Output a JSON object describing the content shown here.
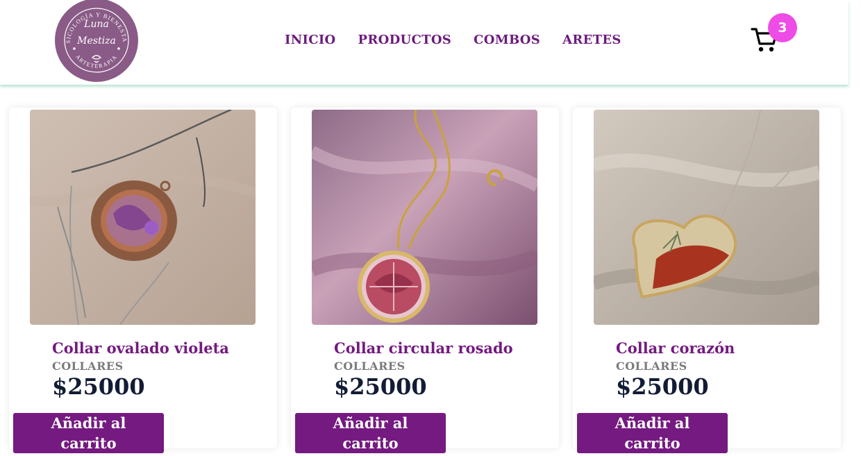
{
  "header": {
    "logo": {
      "arc_top": "PSICOLOGÍA Y BIENESTAR",
      "arc_bottom": "ARTETERAPIA",
      "line1": "Luna",
      "line2": "Mestiza",
      "color": "#8a5b87"
    },
    "nav": [
      "INICIO",
      "PRODUCTOS",
      "COMBOS",
      "ARETES"
    ],
    "cart": {
      "icon": "cart-icon",
      "count": "3",
      "badge_color": "#ee4ce6"
    }
  },
  "colors": {
    "brand": "#741a80",
    "price": "#131c35",
    "category": "#7a7a7a"
  },
  "products": [
    {
      "name": "Collar ovalado violeta",
      "category": "COLLARES",
      "price": "$25000",
      "button": "Añadir al carrito",
      "image": "oval-violet-necklace-photo"
    },
    {
      "name": "Collar circular rosado",
      "category": "COLLARES",
      "price": "$25000",
      "button": "Añadir al carrito",
      "image": "round-pink-necklace-photo"
    },
    {
      "name": "Collar corazón",
      "category": "COLLARES",
      "price": "$25000",
      "button": "Añadir al carrito",
      "image": "heart-necklace-photo"
    }
  ]
}
